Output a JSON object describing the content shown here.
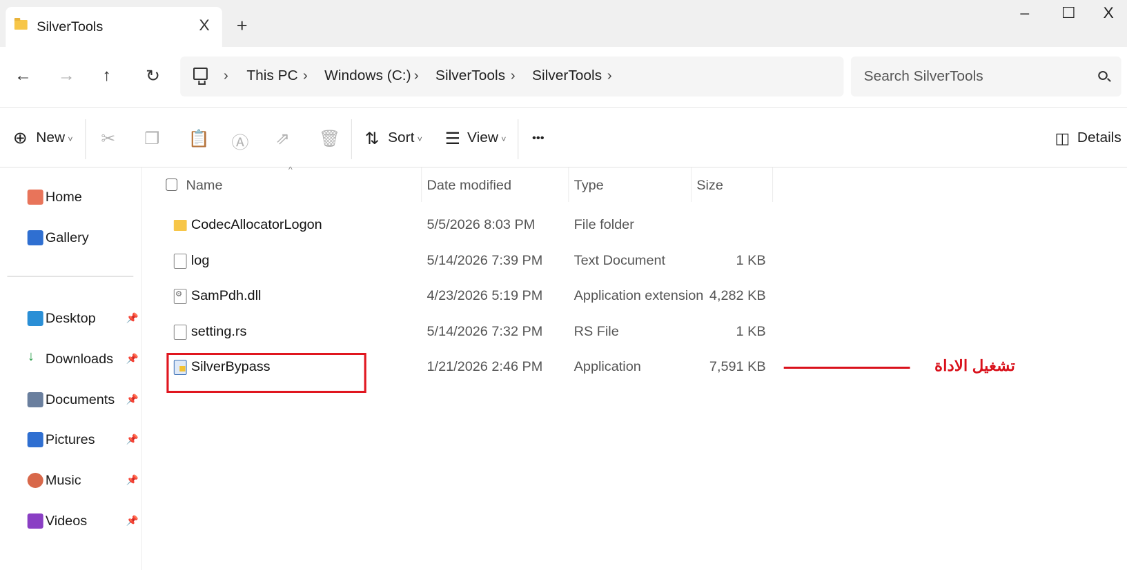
{
  "tab": {
    "title": "SilverTools",
    "close": "X",
    "new": "+"
  },
  "window": {
    "minimize": "–",
    "maximize": "☐",
    "close": "X"
  },
  "nav": {
    "back": "←",
    "forward": "→",
    "up": "↑",
    "refresh": "↻"
  },
  "breadcrumb": [
    "This PC",
    "Windows (C:)",
    "SilverTools",
    "SilverTools"
  ],
  "search": {
    "placeholder": "Search SilverTools"
  },
  "commandbar": {
    "new": "New",
    "sort": "Sort",
    "view": "View",
    "more": "•••",
    "details": "Details",
    "icons": [
      "cut-icon",
      "copy-icon",
      "paste-icon",
      "rename-icon",
      "share-icon",
      "delete-icon"
    ]
  },
  "sidebar": {
    "top": [
      {
        "label": "Home",
        "icon": "home-icon",
        "color": "#e8745a"
      },
      {
        "label": "Gallery",
        "icon": "gallery-icon",
        "color": "#2f6fd1"
      }
    ],
    "pinned": [
      {
        "label": "Desktop",
        "icon": "desktop-icon",
        "color": "#2a8fd6"
      },
      {
        "label": "Downloads",
        "icon": "download-icon",
        "color": "#2a9d4a"
      },
      {
        "label": "Documents",
        "icon": "documents-icon",
        "color": "#6a7f9e"
      },
      {
        "label": "Pictures",
        "icon": "pictures-icon",
        "color": "#2f6fd1"
      },
      {
        "label": "Music",
        "icon": "music-icon",
        "color": "#d8684a"
      },
      {
        "label": "Videos",
        "icon": "videos-icon",
        "color": "#8a3fc4"
      }
    ]
  },
  "columns": {
    "name": "Name",
    "date": "Date modified",
    "type": "Type",
    "size": "Size"
  },
  "files": [
    {
      "name": "CodecAllocatorLogon",
      "date": "5/5/2026 8:03 PM",
      "type": "File folder",
      "size": "",
      "icon": "folder-icon"
    },
    {
      "name": "log",
      "date": "5/14/2026 7:39 PM",
      "type": "Text Document",
      "size": "1 KB",
      "icon": "text-file-icon"
    },
    {
      "name": "SamPdh.dll",
      "date": "4/23/2026 5:19 PM",
      "type": "Application extension",
      "size": "4,282 KB",
      "icon": "dll-file-icon"
    },
    {
      "name": "setting.rs",
      "date": "5/14/2026 7:32 PM",
      "type": "RS File",
      "size": "1 KB",
      "icon": "file-icon"
    },
    {
      "name": "SilverBypass",
      "date": "1/21/2026 2:46 PM",
      "type": "Application",
      "size": "7,591 KB",
      "icon": "application-icon"
    }
  ],
  "annotation": {
    "text": "تشغيل الاداة",
    "color": "#d9111b"
  }
}
